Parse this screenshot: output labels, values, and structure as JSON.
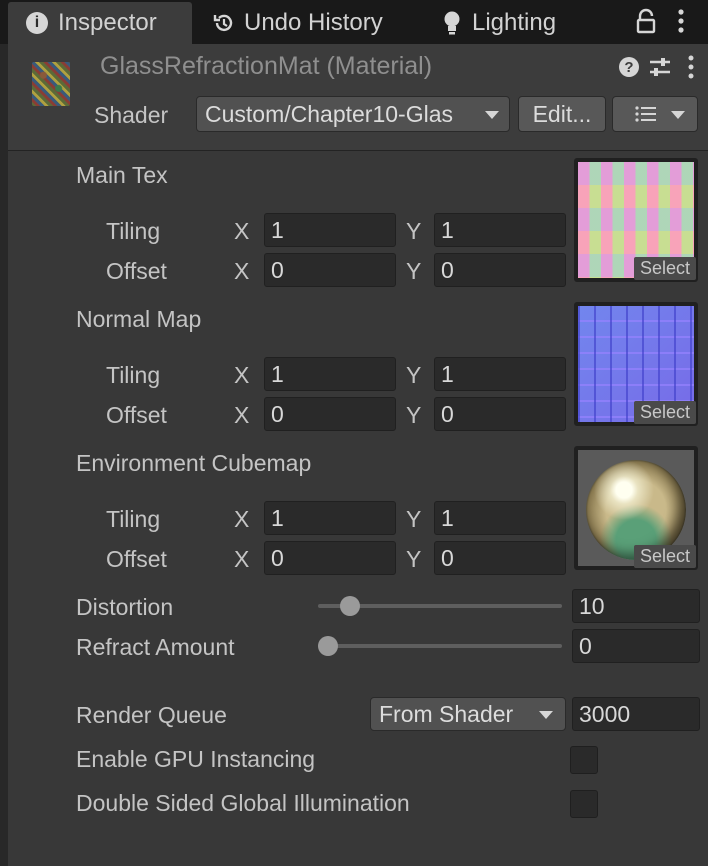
{
  "tabs": {
    "inspector": "Inspector",
    "undo_history": "Undo History",
    "lighting": "Lighting"
  },
  "material": {
    "title": "GlassRefractionMat (Material)",
    "shader_label": "Shader",
    "shader_value": "Custom/Chapter10-Glas",
    "edit_label": "Edit..."
  },
  "props": {
    "main_tex": {
      "label": "Main Tex",
      "tiling_label": "Tiling",
      "offset_label": "Offset",
      "tiling_x": "1",
      "tiling_y": "1",
      "offset_x": "0",
      "offset_y": "0",
      "select": "Select"
    },
    "normal_map": {
      "label": "Normal Map",
      "tiling_label": "Tiling",
      "offset_label": "Offset",
      "tiling_x": "1",
      "tiling_y": "1",
      "offset_x": "0",
      "offset_y": "0",
      "select": "Select"
    },
    "cubemap": {
      "label": "Environment Cubemap",
      "tiling_label": "Tiling",
      "offset_label": "Offset",
      "tiling_x": "1",
      "tiling_y": "1",
      "offset_x": "0",
      "offset_y": "0",
      "select": "Select"
    },
    "axis_x": "X",
    "axis_y": "Y",
    "distortion": {
      "label": "Distortion",
      "value": "10",
      "fraction": 0.13
    },
    "refract_amount": {
      "label": "Refract Amount",
      "value": "0",
      "fraction": 0.0
    },
    "render_queue": {
      "label": "Render Queue",
      "mode": "From Shader",
      "value": "3000"
    },
    "gpu_instancing": {
      "label": "Enable GPU Instancing",
      "checked": false
    },
    "double_sided_gi": {
      "label": "Double Sided Global Illumination",
      "checked": false
    }
  },
  "icons": {
    "inspector": "info-icon",
    "undo": "history-icon",
    "lighting": "bulb-icon",
    "lock": "lock-icon",
    "menu": "kebab-icon",
    "help": "help-icon",
    "preset": "sliders-icon",
    "list": "list-icon"
  }
}
